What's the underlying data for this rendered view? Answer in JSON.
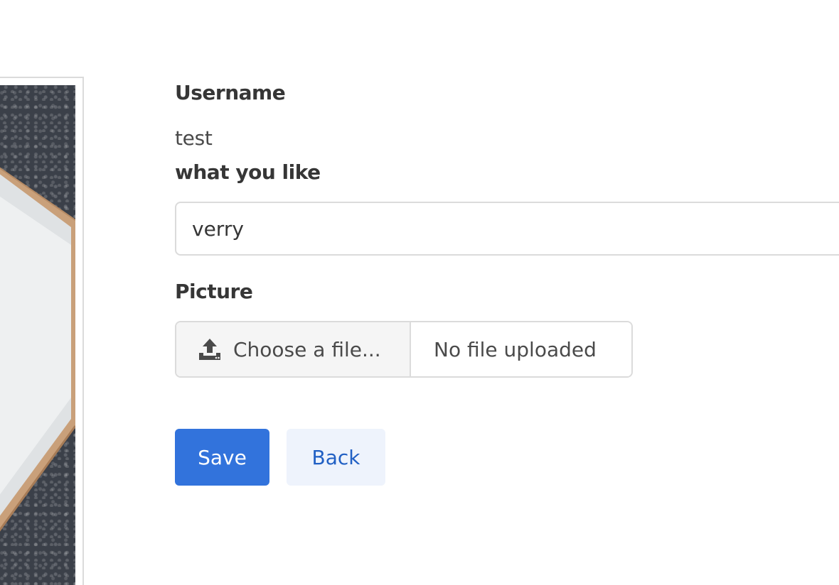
{
  "profile_form": {
    "username_label": "Username",
    "username_value": "test",
    "like_label": "what you like",
    "like_value": "verry",
    "picture_label": "Picture",
    "file_button_label": "Choose a file...",
    "file_button_icon": "upload-icon",
    "file_status": "No file uploaded",
    "save_label": "Save",
    "back_label": "Back"
  },
  "colors": {
    "primary": "#3273dc",
    "link_light_bg": "#eef3fc",
    "link_text": "#2160c4",
    "border": "#dbdbdb"
  }
}
